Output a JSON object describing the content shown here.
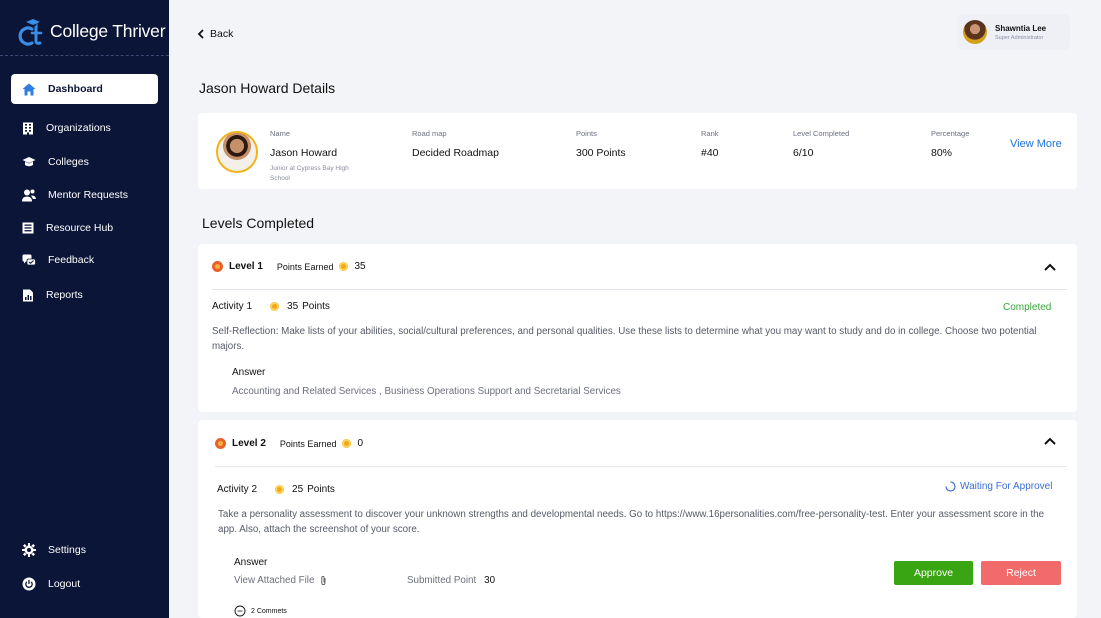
{
  "brand": {
    "name": "College Thriver"
  },
  "sidebar": {
    "items": [
      {
        "label": "Dashboard",
        "icon": "home-icon",
        "active": true
      },
      {
        "label": "Organizations",
        "icon": "building-icon"
      },
      {
        "label": "Colleges",
        "icon": "graduation-cap-icon"
      },
      {
        "label": "Mentor Requests",
        "icon": "users-icon"
      },
      {
        "label": "Resource Hub",
        "icon": "list-icon"
      },
      {
        "label": "Feedback",
        "icon": "chat-icon"
      },
      {
        "label": "Reports",
        "icon": "report-icon"
      }
    ],
    "bottom": [
      {
        "label": "Settings",
        "icon": "gear-icon"
      },
      {
        "label": "Logout",
        "icon": "power-icon"
      }
    ]
  },
  "header": {
    "back_label": "Back",
    "user": {
      "name": "Shawntia Lee",
      "role": "Super Administrator"
    }
  },
  "page": {
    "title": "Jason Howard Details"
  },
  "profile": {
    "name_label": "Name",
    "name": "Jason Howard",
    "school": "Junior at Cypress Bay High School",
    "roadmap_label": "Road map",
    "roadmap": "Decided Roadmap",
    "points_label": "Points",
    "points": "300 Points",
    "rank_label": "Rank",
    "rank": "#40",
    "level_label": "Level Completed",
    "level": "6/10",
    "percentage_label": "Percentage",
    "percentage": "80%",
    "view_more": "View More"
  },
  "levels_section": {
    "title": "Levels Completed"
  },
  "levels": [
    {
      "title": "Level 1",
      "points_label": "Points Earned",
      "points": "35",
      "activity": {
        "name": "Activity 1",
        "points": "35",
        "points_unit": "Points",
        "status": "Completed",
        "description": "Self-Reflection: Make lists of your abilities, social/cultural preferences, and personal qualities. Use these lists to determine what you may want to study and do in college. Choose two potential majors.",
        "answer_label": "Answer",
        "answer": "Accounting and Related Services ,   Business Operations Support and Secretarial Services"
      }
    },
    {
      "title": "Level 2",
      "points_label": "Points Earned",
      "points": "0",
      "activity": {
        "name": "Activity 2",
        "points": "25",
        "points_unit": "Points",
        "status": "Waiting For Approvel",
        "description": "Take a personality assessment to discover your unknown strengths and developmental needs. Go to https://www.16personalities.com/free-personality-test. Enter your assessment score in the app. Also, attach the screenshot of your score.",
        "answer_label": "Answer",
        "attachment_label": "View Attached File",
        "submitted_label": "Submitted Point",
        "submitted_value": "30",
        "approve_label": "Approve",
        "reject_label": "Reject",
        "comments": "2 Commets"
      }
    }
  ],
  "colors": {
    "sidebar": "#0b1537",
    "approve": "#3aa512",
    "reject": "#f26b6b",
    "link": "#1d72d8",
    "completed": "#3ba33a"
  }
}
